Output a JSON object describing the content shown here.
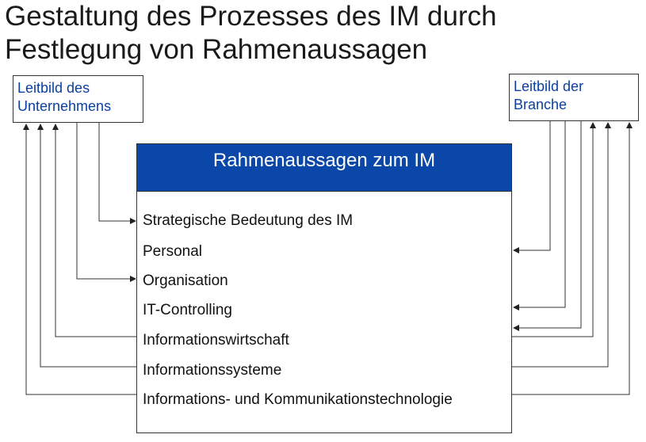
{
  "title": {
    "line1": "Gestaltung des Prozesses des IM durch",
    "line2": "Festlegung von Rahmenaussagen"
  },
  "left_box": {
    "line1": "Leitbild des",
    "line2": "Unternehmens"
  },
  "right_box": {
    "line1": "Leitbild der",
    "line2": "Branche"
  },
  "main_box": {
    "header": "Rahmenaussagen zum IM",
    "items": [
      "Strategische Bedeutung des IM",
      "Personal",
      "Organisation",
      "IT-Controlling",
      "Informationswirtschaft",
      "Informationssysteme",
      "Informations- und Kommunikationstechnologie"
    ]
  },
  "colors": {
    "header_bg": "#0a47a8",
    "box_text": "#0b3fa0",
    "line": "#333333"
  }
}
